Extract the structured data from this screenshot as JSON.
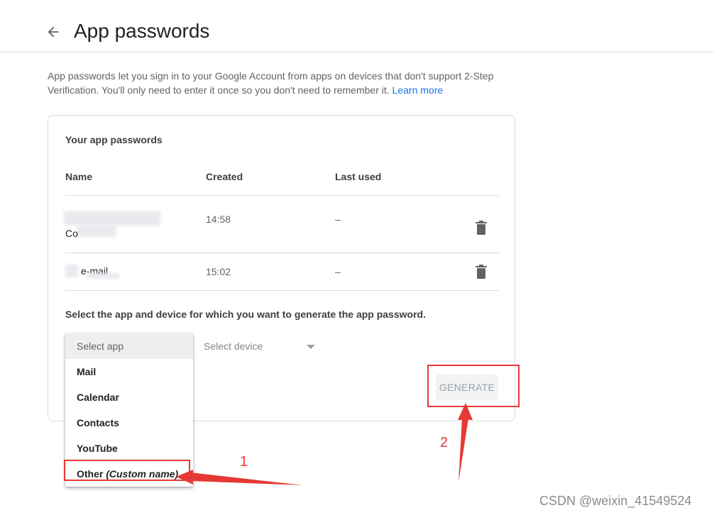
{
  "header": {
    "title": "App passwords"
  },
  "intro": {
    "text_line1": "App passwords let you sign in to your Google Account from apps on devices that don't support 2-Step",
    "text_line2": "Verification. You'll only need to enter it once so you don't need to remember it.",
    "learn_more": "Learn more"
  },
  "card": {
    "title": "Your app passwords",
    "columns": [
      "Name",
      "Created",
      "Last used"
    ],
    "rows": [
      {
        "name": "Co",
        "created": "14:58",
        "last_used": "–"
      },
      {
        "name": "e-mail",
        "created": "15:02",
        "last_used": "–"
      }
    ],
    "select_label": "Select the app and device for which you want to generate the app password.",
    "device_placeholder": "Select device",
    "generate_label": "GENERATE"
  },
  "dropdown": {
    "selected": "Select app",
    "options": [
      "Mail",
      "Calendar",
      "Contacts",
      "YouTube"
    ],
    "other_label": "Other",
    "other_hint": "(Custom name)"
  },
  "annotations": {
    "one": "1",
    "two": "2"
  },
  "watermark": "CSDN @weixin_41549524",
  "colors": {
    "accent": "#1a73e8",
    "annotation": "#e53935",
    "border": "#dadce0"
  }
}
